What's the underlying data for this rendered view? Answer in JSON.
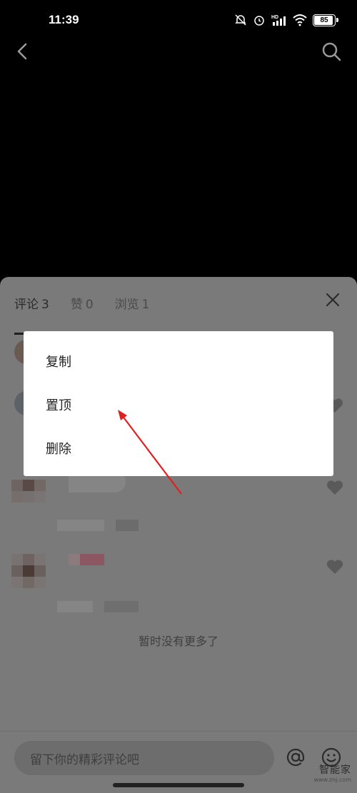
{
  "status": {
    "time": "11:39",
    "battery": "85",
    "icons": [
      "mute-bell-icon",
      "alarm-icon",
      "hd-signal-icon",
      "wifi-icon",
      "battery-icon"
    ]
  },
  "nav": {
    "icons": [
      "back-arrow-icon",
      "search-icon"
    ]
  },
  "tabs": [
    {
      "label": "评论",
      "count": "3"
    },
    {
      "label": "赞",
      "count": "0"
    },
    {
      "label": "浏览",
      "count": "1"
    }
  ],
  "empty_text": "暂时没有更多了",
  "input": {
    "placeholder": "留下你的精彩评论吧"
  },
  "context_menu": {
    "items": [
      "复制",
      "置顶",
      "删除"
    ]
  },
  "watermark": {
    "main": "智能家",
    "sub": "www.znj.com"
  },
  "colors": {
    "overlay": "#7a7a7a",
    "annotation_arrow": "#e02020"
  }
}
